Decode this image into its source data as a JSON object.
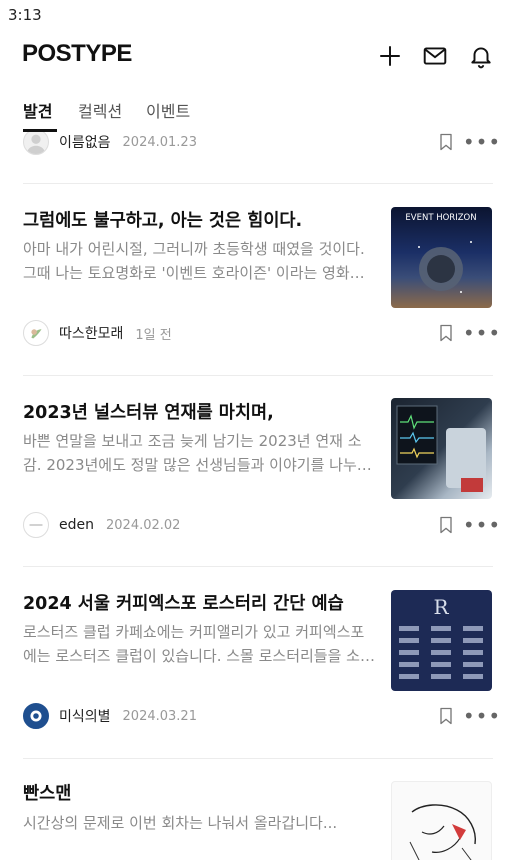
{
  "status": {
    "time": "3:13"
  },
  "header": {
    "brand": "POSTYPE",
    "icons": [
      "plus-icon",
      "mail-icon",
      "bell-icon"
    ]
  },
  "tabs": [
    {
      "label": "발견",
      "active": true
    },
    {
      "label": "컬렉션",
      "active": false
    },
    {
      "label": "이벤트",
      "active": false
    }
  ],
  "prev_post": {
    "author": "이름없음",
    "date": "2024.01.23"
  },
  "posts": [
    {
      "title": "그럼에도 불구하고, 아는 것은 힘이다.",
      "excerpt": "아마 내가 어린시절, 그러니까 초등학생 때였을 것이다. 그때 나는 토요명화로 '이벤트 호라이즌' 이라는 영화를 봤다.",
      "author": "따스한모래",
      "date": "1일 전",
      "thumb_text": "EVENT HORIZON"
    },
    {
      "title": "2023년 널스터뷰 연재를 마치며,",
      "excerpt": "바쁜 연말을 보내고 조금 늦게 남기는 2023년 연재 소감. 2023년에도 정말 많은 선생님들과 이야기를 나누었습니다.",
      "author": "eden",
      "date": "2024.02.02",
      "thumb_text": ""
    },
    {
      "title": "2024 서울 커피엑스포 로스터리 간단 예습",
      "excerpt": "로스터즈 클럽 카페쇼에는 커피앨리가 있고 커피엑스포에는 로스터즈 클럽이 있습니다. 스몰 로스터리들을 소개합니다.",
      "author": "미식의별",
      "date": "2024.03.21",
      "thumb_text": "R"
    },
    {
      "title": "빤스맨",
      "excerpt": "시간상의 문제로 이번 회차는 나눠서 올라갑니다...",
      "author": "",
      "date": "",
      "thumb_text": ""
    }
  ],
  "colors": {
    "text": "#111111",
    "muted": "#8a8a8a",
    "divider": "#ececec"
  }
}
